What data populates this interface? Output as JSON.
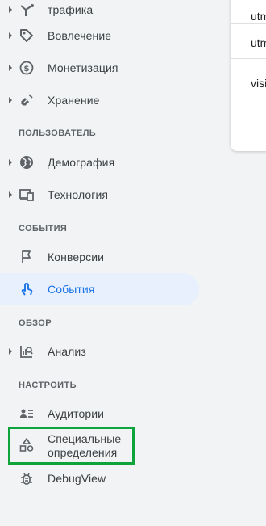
{
  "nav": {
    "traffic_label": "трафика",
    "engagement_label": "Вовлечение",
    "monetization_label": "Монетизация",
    "retention_label": "Хранение",
    "section_user": "ПОЛЬЗОВАТЕЛЬ",
    "demography_label": "Демография",
    "technology_label": "Технология",
    "section_events": "СОБЫТИЯ",
    "conversions_label": "Конверсии",
    "events_label": "События",
    "section_overview": "ОБЗОР",
    "analysis_label": "Анализ",
    "section_configure": "НАСТРОИТЬ",
    "audiences_label": "Аудитории",
    "custom_definitions_line1": "Специальные",
    "custom_definitions_line2": "определения",
    "debugview_label": "DebugView"
  },
  "table": {
    "rows": [
      "utm",
      "utm",
      "visi"
    ]
  },
  "colors": {
    "background": "#f1f3f4",
    "active_bg": "#e8f0fe",
    "active_text": "#1a73e8",
    "highlight_border": "#0ea43b"
  }
}
